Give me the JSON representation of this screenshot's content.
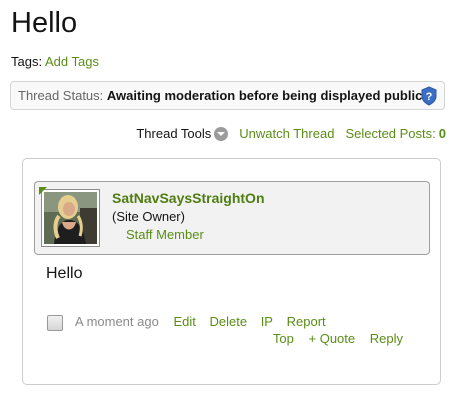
{
  "page": {
    "title": "Hello"
  },
  "tags": {
    "label": "Tags:",
    "add_link": "Add Tags"
  },
  "thread_status": {
    "label": "Thread Status:",
    "value": "Awaiting moderation before being displayed publicly.",
    "icon": "shield-question-icon",
    "icon_color": "#3b6fc6"
  },
  "toolbar": {
    "thread_tools": "Thread Tools",
    "unwatch": "Unwatch Thread",
    "selected_posts_label": "Selected Posts:",
    "selected_posts_count": "0"
  },
  "post": {
    "user": {
      "name": "SatNavSaysStraightOn",
      "title": "(Site Owner)",
      "badge": "Staff Member"
    },
    "message": "Hello",
    "time": "A moment ago",
    "actions": [
      "Edit",
      "Delete",
      "IP",
      "Report"
    ],
    "secondary_actions": [
      "Top",
      "+ Quote",
      "Reply"
    ]
  },
  "colors": {
    "link": "#5a8d16",
    "username": "#4f7d12"
  }
}
